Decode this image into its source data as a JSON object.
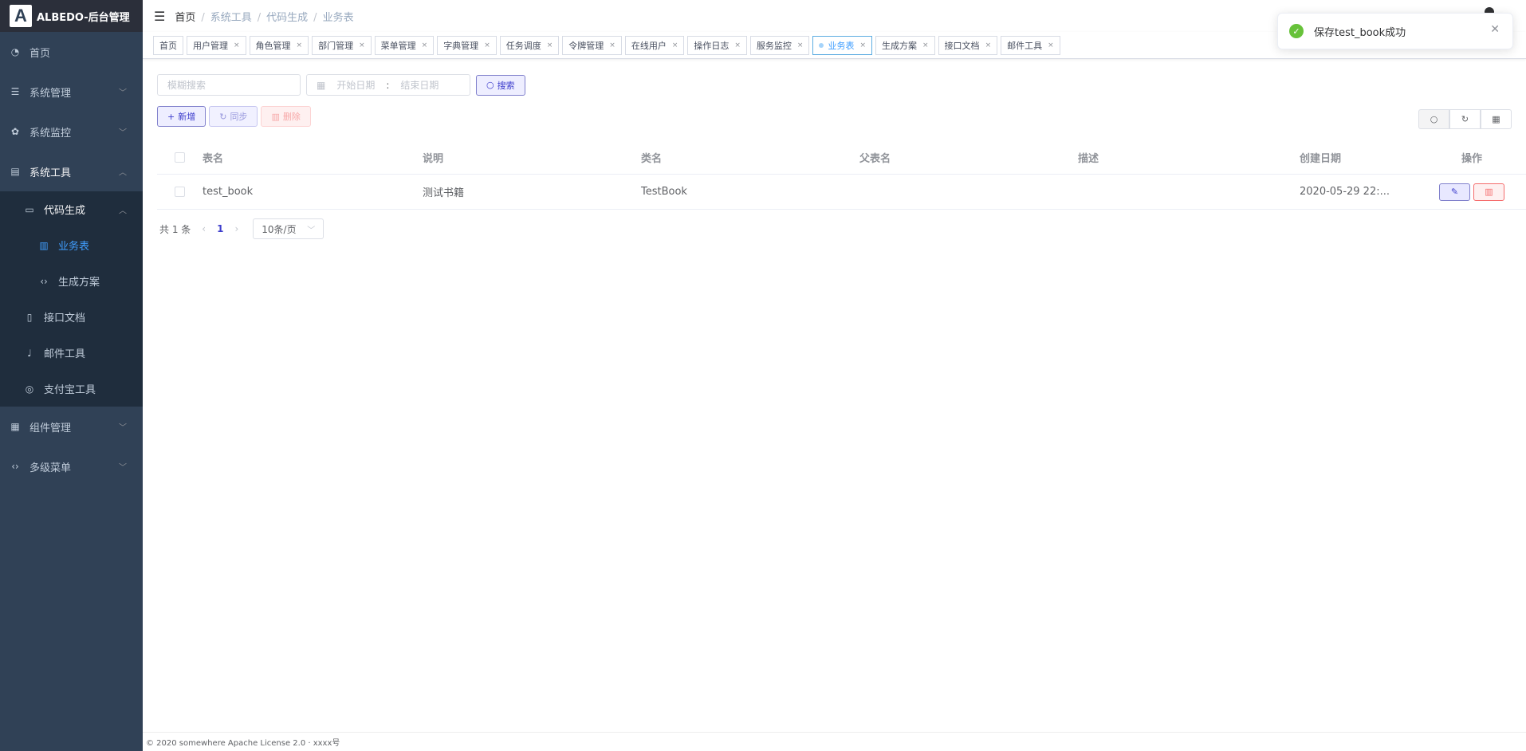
{
  "app": {
    "logo_letter": "A",
    "title": "ALBEDO-后台管理"
  },
  "sidebar": {
    "home": "首页",
    "system_manage": "系统管理",
    "system_monitor": "系统监控",
    "system_tools": "系统工具",
    "code_gen": "代码生成",
    "business_table": "业务表",
    "gen_scheme": "生成方案",
    "api_docs": "接口文档",
    "mail_tool": "邮件工具",
    "alipay_tool": "支付宝工具",
    "component_manage": "组件管理",
    "multi_menu": "多级菜单"
  },
  "breadcrumb": [
    "首页",
    "系统工具",
    "代码生成",
    "业务表"
  ],
  "tags": [
    "首页",
    "用户管理",
    "角色管理",
    "部门管理",
    "菜单管理",
    "字典管理",
    "任务调度",
    "令牌管理",
    "在线用户",
    "操作日志",
    "服务监控",
    "业务表",
    "生成方案",
    "接口文档",
    "邮件工具"
  ],
  "active_tag": "业务表",
  "filters": {
    "search_placeholder": "模糊搜索",
    "start_date_placeholder": "开始日期",
    "end_date_placeholder": "结束日期",
    "range_sep": ":",
    "search_button": "搜索"
  },
  "actions": {
    "add": "新增",
    "sync": "同步",
    "delete": "删除"
  },
  "table": {
    "columns": [
      "表名",
      "说明",
      "类名",
      "父表名",
      "描述",
      "创建日期",
      "操作"
    ],
    "rows": [
      {
        "table_name": "test_book",
        "comment": "测试书籍",
        "class_name": "TestBook",
        "parent": "",
        "remark": "",
        "created": "2020-05-29 22:..."
      }
    ]
  },
  "pagination": {
    "total": "共 1 条",
    "current": "1",
    "page_size": "10条/页"
  },
  "footer": "© 2020 somewhere Apache License 2.0 · xxxx号",
  "toast": {
    "message": "保存test_book成功"
  },
  "colors": {
    "sidebar_bg": "#304156",
    "active": "#409eff",
    "primary": "#3d3dcc",
    "success": "#67c23a",
    "danger": "#f56c6c"
  }
}
